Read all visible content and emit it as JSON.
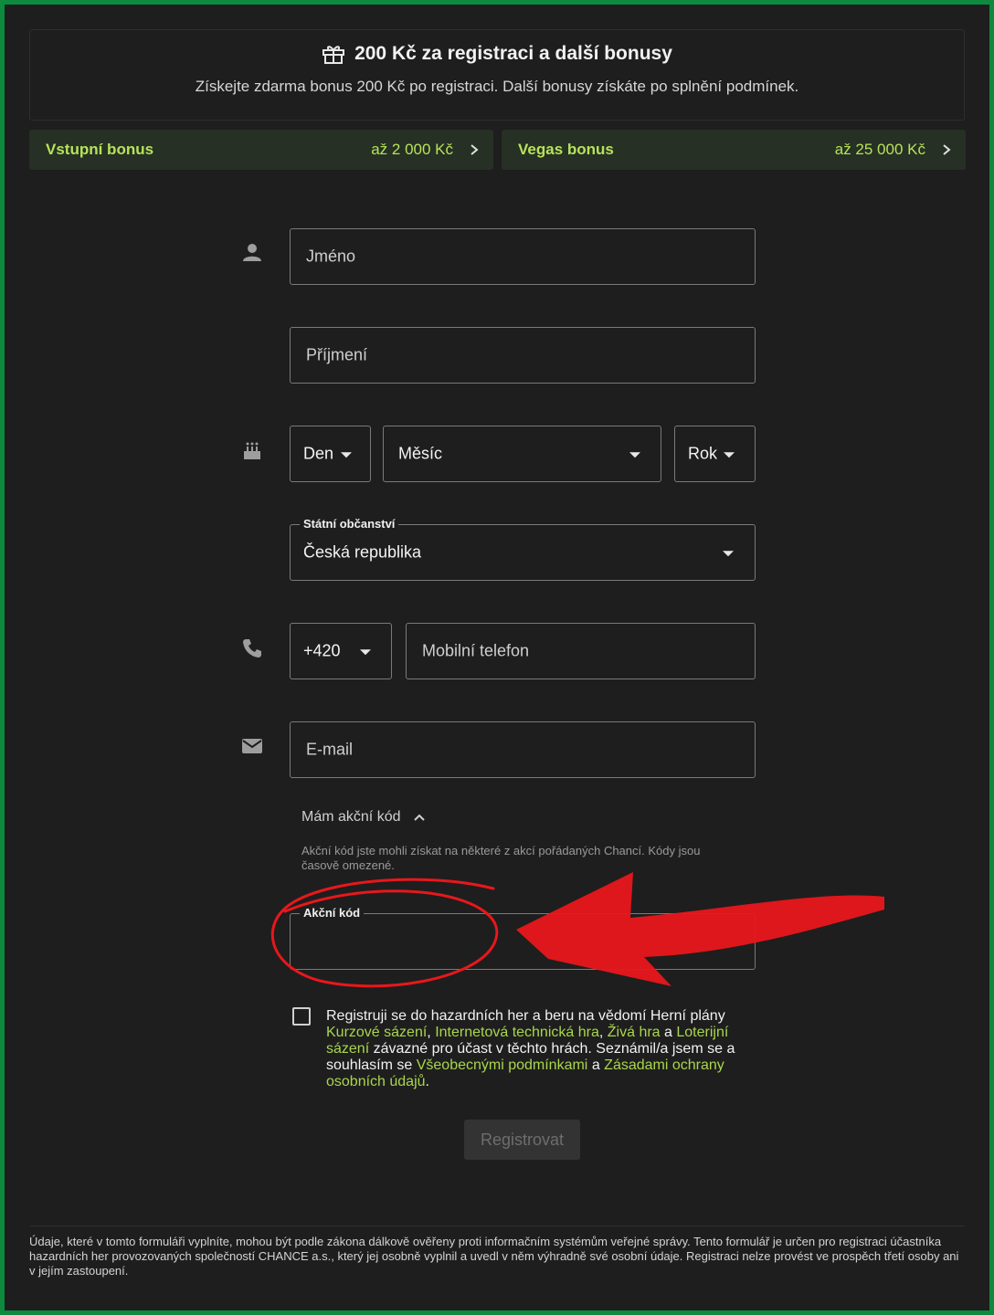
{
  "promo": {
    "title": "200 Kč za registraci a další bonusy",
    "subtitle": "Získejte zdarma bonus 200 Kč po registraci. Další bonusy získáte po splnění podmínek."
  },
  "bonuses": [
    {
      "name": "Vstupní bonus",
      "amount": "až 2 000 Kč"
    },
    {
      "name": "Vegas bonus",
      "amount": "až 25 000 Kč"
    }
  ],
  "form": {
    "first_name_placeholder": "Jméno",
    "last_name_placeholder": "Příjmení",
    "day": "Den",
    "month": "Měsíc",
    "year": "Rok",
    "citizenship_label": "Státní občanství",
    "citizenship_value": "Česká republika",
    "phone_prefix": "+420",
    "phone_placeholder": "Mobilní telefon",
    "email_placeholder": "E-mail",
    "promo_toggle": "Mám akční kód",
    "promo_hint": "Akční kód jste mohli získat na některé z akcí pořádaných Chancí. Kódy jsou časově omezené.",
    "promo_code_label": "Akční kód",
    "submit": "Registrovat"
  },
  "terms": {
    "t1": "Registruji se do hazardních her a beru na vědomí Herní plány",
    "l1": "Kurzové sázení",
    "t2": ",",
    "l2": "Internetová technická hra",
    "t3": ",",
    "l3": "Živá hra",
    "t4": "a",
    "l4": "Loterijní sázení",
    "t5": "závazné pro účast v těchto hrách. Seznámil/a jsem se a souhlasím se",
    "l5": "Všeobecnými podmínkami",
    "t6": "a",
    "l6": "Zásadami ochrany osobních údajů",
    "t7": "."
  },
  "footer": "Údaje, které v tomto formuláři vyplníte, mohou být podle zákona dálkově ověřeny proti informačním systémům veřejné správy. Tento formulář je určen pro registraci účastníka hazardních her provozovaných společností CHANCE a.s., který jej osobně vyplnil a uvedl v něm výhradně své osobní údaje. Registraci nelze provést ve prospěch třetí osoby ani v jejím zastoupení.",
  "icons": [
    "gift-icon",
    "person-icon",
    "cake-icon",
    "phone-icon",
    "mail-icon",
    "chevron-right-icon",
    "chevron-up-icon"
  ],
  "colors": {
    "accent": "#b7e25b",
    "frame": "#0d8a3e",
    "annotation": "#e8171b"
  }
}
